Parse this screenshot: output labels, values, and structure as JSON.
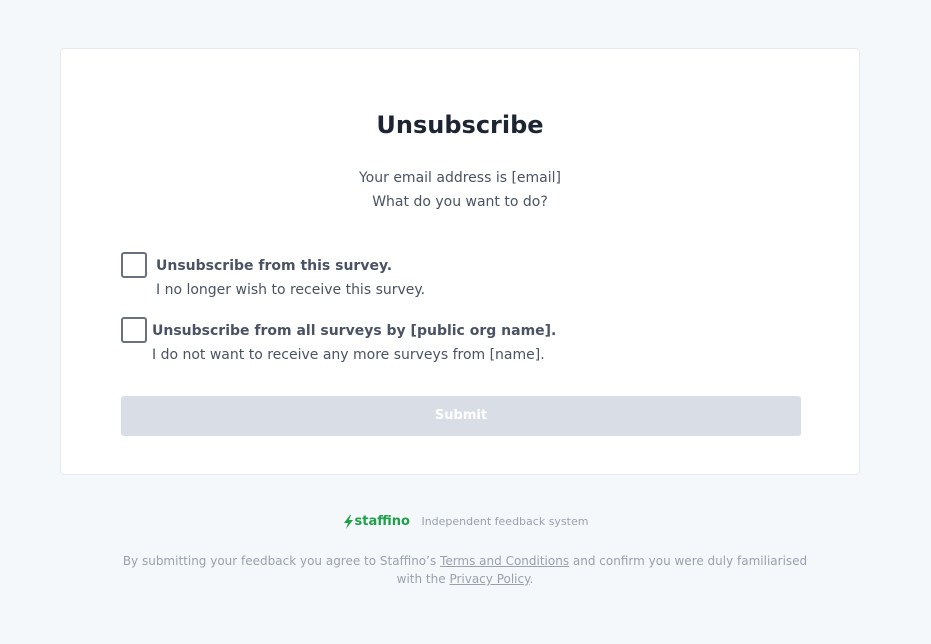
{
  "form": {
    "title": "Unsubscribe",
    "intro_line1": "Your email address is [email]",
    "intro_line2": "What do you want to do?",
    "options": [
      {
        "title": "Unsubscribe from this survey.",
        "description": "I no longer wish to receive this survey.",
        "checked": false
      },
      {
        "title": "Unsubscribe from all surveys by [public org name].",
        "description": "I do not want to receive any more surveys from [name].",
        "checked": false
      }
    ],
    "submit_label": "Submit"
  },
  "footer": {
    "brand_name": "staffino",
    "brand_color": "#1fa14a",
    "brand_icon": "lightning-bolt-icon",
    "tagline": "Independent feedback system",
    "legal_prefix": "By submitting your feedback you agree to Staffino’s ",
    "terms_link": "Terms and Conditions",
    "legal_middle": " and confirm you were duly familiarised with the ",
    "privacy_link": "Privacy Policy",
    "legal_suffix": "."
  }
}
